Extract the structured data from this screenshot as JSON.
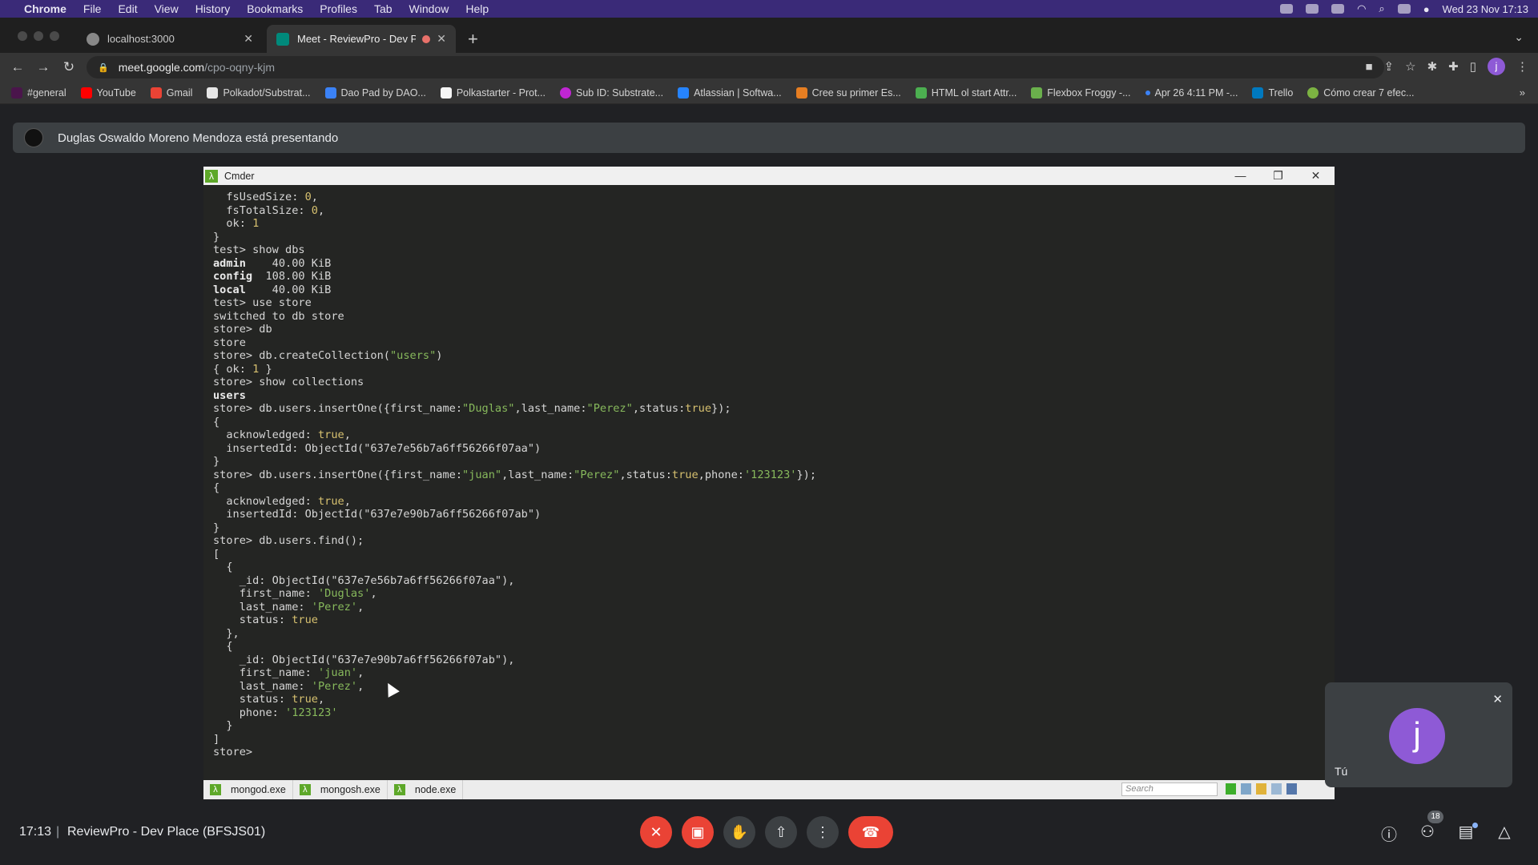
{
  "menubar": {
    "app": "Chrome",
    "items": [
      "File",
      "Edit",
      "View",
      "History",
      "Bookmarks",
      "Profiles",
      "Tab",
      "Window",
      "Help"
    ],
    "datetime": "Wed 23 Nov  17:13"
  },
  "tabs": [
    {
      "title": "localhost:3000",
      "close": "✕"
    },
    {
      "title": "Meet - ReviewPro - Dev Pl",
      "close": "✕"
    }
  ],
  "omnibox": {
    "host": "meet.google.com",
    "path": "/cpo-oqny-kjm"
  },
  "bookmarks": [
    {
      "label": "#general",
      "color": "#4a154b"
    },
    {
      "label": "YouTube",
      "color": "#ff0000"
    },
    {
      "label": "Gmail",
      "color": "#ea4335"
    },
    {
      "label": "Polkadot/Substrat...",
      "color": "#e6e6e6"
    },
    {
      "label": "Dao Pad by DAO...",
      "color": "#3b82f6"
    },
    {
      "label": "Polkastarter - Prot...",
      "color": "#f5f5f5"
    },
    {
      "label": "Sub ID: Substrate...",
      "color": "#c026d3"
    },
    {
      "label": "Atlassian | Softwa...",
      "color": "#2684ff"
    },
    {
      "label": "Cree su primer Es...",
      "color": "#e67e22"
    },
    {
      "label": "HTML ol start Attr...",
      "color": "#4caf50"
    },
    {
      "label": "Flexbox Froggy -...",
      "color": "#6ab04c"
    },
    {
      "label": "Apr 26 4:11 PM -...",
      "color": "#3b82f6"
    },
    {
      "label": "Trello",
      "color": "#0079bf"
    },
    {
      "label": "Cómo crear 7 efec...",
      "color": "#7cb342"
    }
  ],
  "presenting": {
    "text": "Duglas Oswaldo Moreno Mendoza está presentando"
  },
  "cmder": {
    "title": "Cmder",
    "console_lines": [
      [
        {
          "t": "  fsUsedSize: "
        },
        {
          "t": "0",
          "c": "num"
        },
        {
          "t": ","
        }
      ],
      [
        {
          "t": "  fsTotalSize: "
        },
        {
          "t": "0",
          "c": "num"
        },
        {
          "t": ","
        }
      ],
      [
        {
          "t": "  ok: "
        },
        {
          "t": "1",
          "c": "num"
        }
      ],
      [
        {
          "t": "}"
        }
      ],
      [
        {
          "t": "test> show dbs"
        }
      ],
      [
        {
          "t": "admin",
          "c": "bold"
        },
        {
          "t": "    40.00 KiB"
        }
      ],
      [
        {
          "t": "config",
          "c": "bold"
        },
        {
          "t": "  108.00 KiB"
        }
      ],
      [
        {
          "t": "local",
          "c": "bold"
        },
        {
          "t": "    40.00 KiB"
        }
      ],
      [
        {
          "t": "test> use store"
        }
      ],
      [
        {
          "t": "switched to db store"
        }
      ],
      [
        {
          "t": "store> db"
        }
      ],
      [
        {
          "t": "store"
        }
      ],
      [
        {
          "t": "store> db.createCollection("
        },
        {
          "t": "\"users\"",
          "c": "str"
        },
        {
          "t": ")"
        }
      ],
      [
        {
          "t": "{ ok: "
        },
        {
          "t": "1",
          "c": "num"
        },
        {
          "t": " }"
        }
      ],
      [
        {
          "t": "store> show collections"
        }
      ],
      [
        {
          "t": "users",
          "c": "bold"
        }
      ],
      [
        {
          "t": "store> db.users.insertOne({first_name:"
        },
        {
          "t": "\"Duglas\"",
          "c": "str"
        },
        {
          "t": ",last_name:"
        },
        {
          "t": "\"Perez\"",
          "c": "str"
        },
        {
          "t": ",status:"
        },
        {
          "t": "true",
          "c": "bool"
        },
        {
          "t": "});"
        }
      ],
      [
        {
          "t": "{"
        }
      ],
      [
        {
          "t": "  acknowledged: "
        },
        {
          "t": "true",
          "c": "bool"
        },
        {
          "t": ","
        }
      ],
      [
        {
          "t": "  insertedId: ObjectId(\"637e7e56b7a6ff56266f07aa\")"
        }
      ],
      [
        {
          "t": "}"
        }
      ],
      [
        {
          "t": "store> db.users.insertOne({first_name:"
        },
        {
          "t": "\"juan\"",
          "c": "str"
        },
        {
          "t": ",last_name:"
        },
        {
          "t": "\"Perez\"",
          "c": "str"
        },
        {
          "t": ",status:"
        },
        {
          "t": "true",
          "c": "bool"
        },
        {
          "t": ",phone:"
        },
        {
          "t": "'123123'",
          "c": "str"
        },
        {
          "t": "});"
        }
      ],
      [
        {
          "t": "{"
        }
      ],
      [
        {
          "t": "  acknowledged: "
        },
        {
          "t": "true",
          "c": "bool"
        },
        {
          "t": ","
        }
      ],
      [
        {
          "t": "  insertedId: ObjectId(\"637e7e90b7a6ff56266f07ab\")"
        }
      ],
      [
        {
          "t": "}"
        }
      ],
      [
        {
          "t": "store> db.users.find();"
        }
      ],
      [
        {
          "t": "["
        }
      ],
      [
        {
          "t": "  {"
        }
      ],
      [
        {
          "t": "    _id: ObjectId(\"637e7e56b7a6ff56266f07aa\"),"
        }
      ],
      [
        {
          "t": "    first_name: "
        },
        {
          "t": "'Duglas'",
          "c": "str"
        },
        {
          "t": ","
        }
      ],
      [
        {
          "t": "    last_name: "
        },
        {
          "t": "'Perez'",
          "c": "str"
        },
        {
          "t": ","
        }
      ],
      [
        {
          "t": "    status: "
        },
        {
          "t": "true",
          "c": "bool"
        }
      ],
      [
        {
          "t": "  },"
        }
      ],
      [
        {
          "t": "  {"
        }
      ],
      [
        {
          "t": "    _id: ObjectId(\"637e7e90b7a6ff56266f07ab\"),"
        }
      ],
      [
        {
          "t": "    first_name: "
        },
        {
          "t": "'juan'",
          "c": "str"
        },
        {
          "t": ","
        }
      ],
      [
        {
          "t": "    last_name: "
        },
        {
          "t": "'Perez'",
          "c": "str"
        },
        {
          "t": ","
        }
      ],
      [
        {
          "t": "    status: "
        },
        {
          "t": "true",
          "c": "bool"
        },
        {
          "t": ","
        }
      ],
      [
        {
          "t": "    phone: "
        },
        {
          "t": "'123123'",
          "c": "str"
        }
      ],
      [
        {
          "t": "  }"
        }
      ],
      [
        {
          "t": "]"
        }
      ],
      [
        {
          "t": "store> "
        }
      ]
    ],
    "status_tabs": [
      "mongod.exe",
      "mongosh.exe",
      "node.exe"
    ],
    "search_placeholder": "Search"
  },
  "self_tile": {
    "initial": "j",
    "name": "Tú"
  },
  "bottom": {
    "time": "17:13",
    "separator": "|",
    "meeting_name": "ReviewPro - Dev Place (BFSJS01)",
    "participants_count": "18"
  },
  "colors": {
    "end_call": "#ea4335",
    "avatar": "#8e5ad6",
    "menubar": "#3a2a78"
  }
}
